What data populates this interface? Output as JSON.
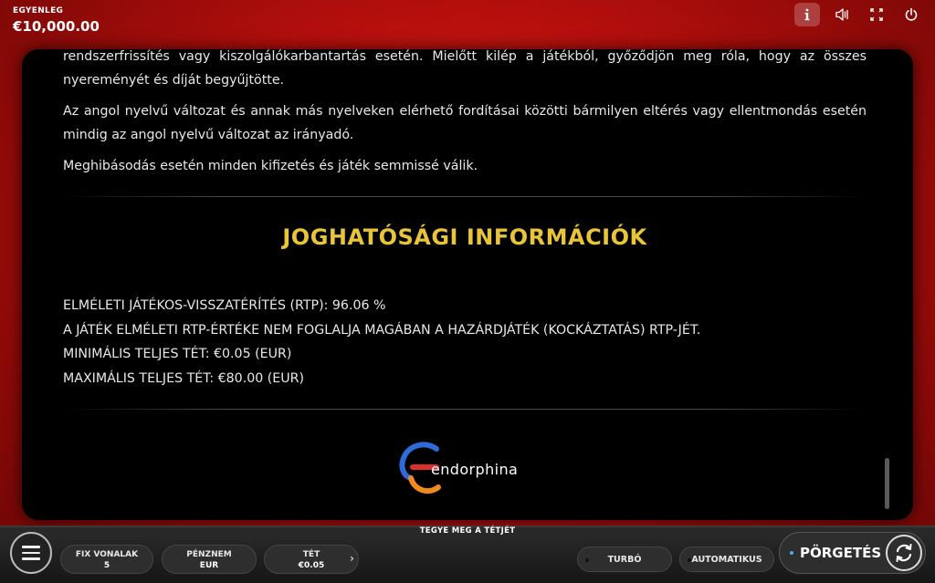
{
  "header": {
    "balance_label": "EGYENLEG",
    "balance_value": "€10,000.00",
    "icons": [
      "info-icon",
      "sound-icon",
      "fullscreen-icon",
      "power-icon"
    ]
  },
  "content": {
    "paragraphs": [
      "rendszerfrissítés vagy kiszolgálókarbantartás esetén. Mielőtt kilép a játékból, győződjön meg róla, hogy az összes nyereményét és díját begyűjtötte.",
      "Az angol nyelvű változat és annak más nyelveken elérhető fordításai közötti bármilyen eltérés vagy ellentmondás esetén mindig az angol nyelvű változat az irányadó.",
      "Meghibásodás esetén minden kifizetés és játék semmissé válik."
    ],
    "section_title": "JOGHATÓSÁGI INFORMÁCIÓK",
    "info_lines": [
      "ELMÉLETI JÁTÉKOS-VISSZATÉRÍTÉS (RTP): 96.06 %",
      "A JÁTÉK ELMÉLETI RTP-ÉRTÉKE NEM FOGLALJA MAGÁBAN A HAZÁRDJÁTÉK (KOCKÁZTATÁS) RTP-JÉT.",
      "MINIMÁLIS TELJES TÉT: €0.05 (EUR)",
      "MAXIMÁLIS TELJES TÉT: €80.00 (EUR)"
    ],
    "logo_text": "endorphina"
  },
  "footer": {
    "bet_prompt": "TEGYE MEG A TÉTJÉT",
    "lines_label": "FIX VONALAK",
    "lines_value": "5",
    "currency_label": "PÉNZNEM",
    "currency_value": "EUR",
    "bet_label": "TÉT",
    "bet_value": "€0.05",
    "turbo_label": "TURBÓ",
    "auto_label": "AUTOMATIKUS",
    "spin_label": "PÖRGETÉS"
  },
  "colors": {
    "background": "#c8140f",
    "title_gold": "#e8c43a",
    "panel": "#000000",
    "spin_indicator": "#4ab0f0"
  }
}
